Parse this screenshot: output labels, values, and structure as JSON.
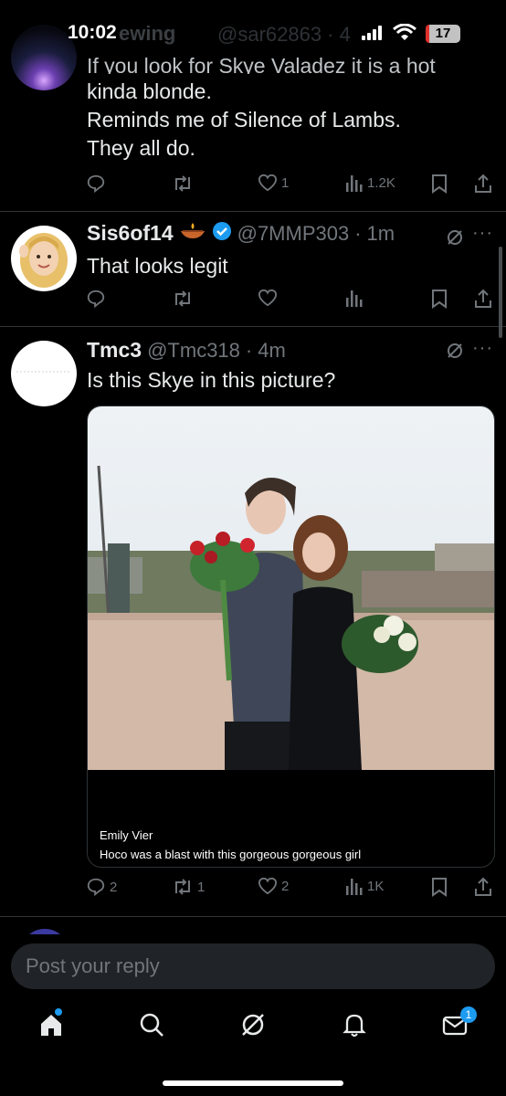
{
  "status_bar": {
    "time": "10:02",
    "battery": "17",
    "overlay_name": "ewing",
    "overlay_handle": "@sar62863 · 4"
  },
  "tweets": [
    {
      "lines": [
        "If you look for Skye Valadez it is a hot",
        "kinda blonde.",
        "Reminds me of Silence of Lambs.",
        "They all do."
      ],
      "reply_count": "",
      "retweet_count": "",
      "like_count": "1",
      "views": "1.2K"
    },
    {
      "name": "Sis6of14",
      "handle": "@7MMP303",
      "time": "1m",
      "text": "That looks legit",
      "reply_count": "",
      "retweet_count": "",
      "like_count": "",
      "views": ""
    },
    {
      "name": "Tmc3",
      "handle": "@Tmc318",
      "time": "4m",
      "text": "Is this Skye in this picture?",
      "media_caption_name": "Emily Vier",
      "media_caption_text": "Hoco was a blast with this gorgeous gorgeous girl",
      "reply_count": "2",
      "retweet_count": "1",
      "like_count": "2",
      "views": "1K"
    }
  ],
  "reply_placeholder": "Post your reply",
  "nav": {
    "items": [
      "home-icon",
      "search-icon",
      "grok-icon",
      "notifications-icon",
      "messages-icon"
    ],
    "messages_badge": "1"
  },
  "colors": {
    "background": "#000000",
    "text": "#e7e9ea",
    "muted": "#71767b",
    "accent": "#1d9bf0",
    "divider": "#2f3336"
  }
}
